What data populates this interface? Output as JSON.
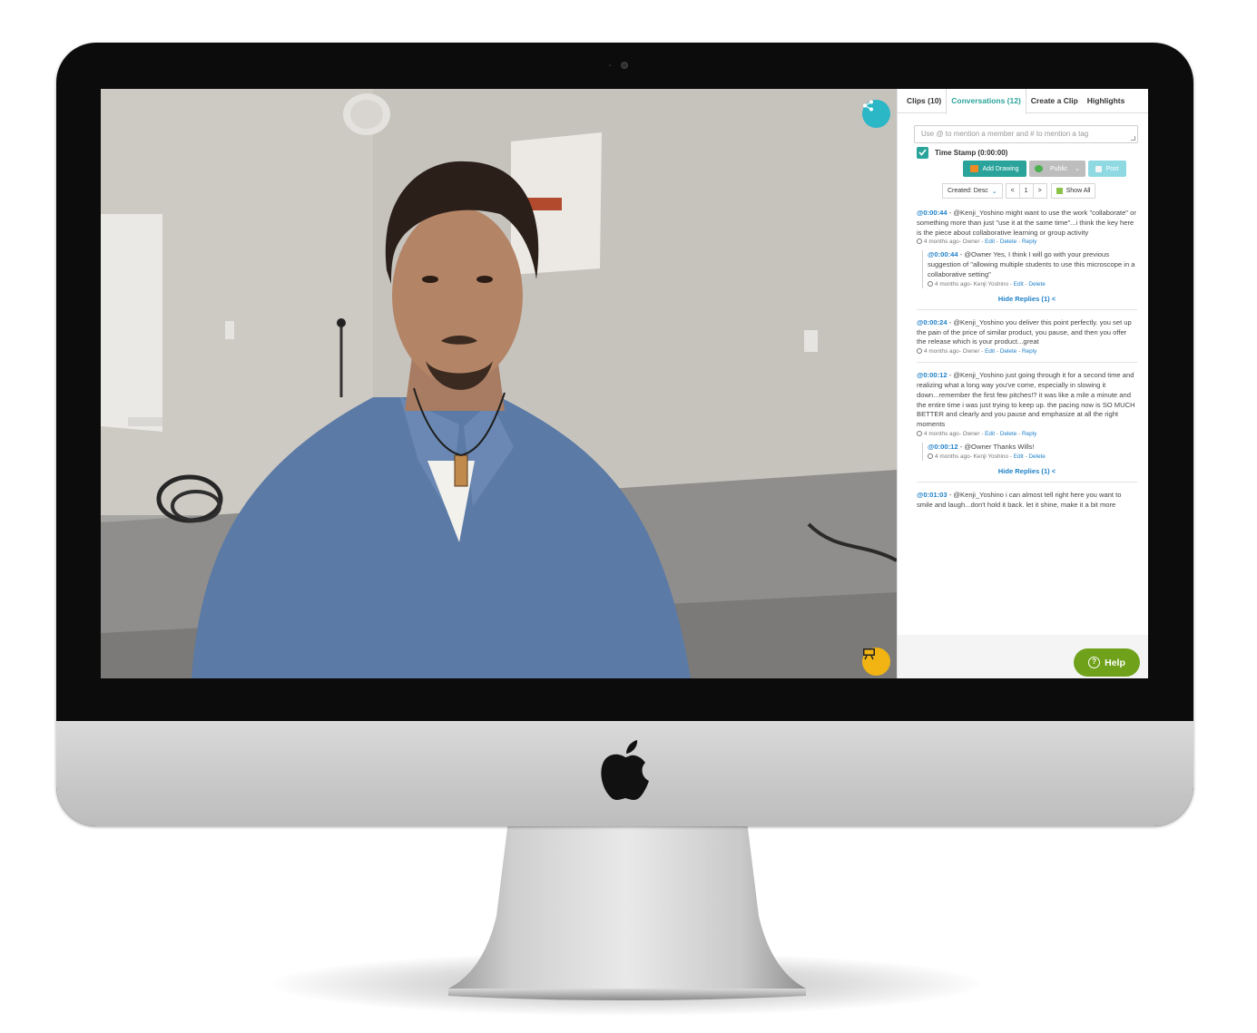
{
  "panel": {
    "tabs": [
      {
        "label": "Clips (10)",
        "active": false
      },
      {
        "label": "Conversations (12)",
        "active": true
      },
      {
        "label": "Create a Clip",
        "active": false
      },
      {
        "label": "Highlights",
        "active": false
      }
    ],
    "composer_placeholder": "Use @ to mention a member and # to mention a tag",
    "timestamp_label": "Time Stamp (0:00:00)",
    "timestamp_checked": true,
    "add_drawing_label": "Add Drawing",
    "visibility_value": "Public",
    "post_label": "Post",
    "sort_value": "Created: Desc",
    "pager": {
      "prev": "<",
      "page": "1",
      "next": ">"
    },
    "show_all_label": "Show All",
    "help_label": "Help"
  },
  "comments": [
    {
      "timestamp": "@0:00:44",
      "text": " - @Kenji_Yoshino might want to use the work \"collaborate\" or something more than just \"use it at the same time\"...i think the key here is the piece about collaborative learning or group activity",
      "meta_prefix": "4 months ago- Owner - ",
      "actions": [
        "Edit",
        "Delete",
        "Reply"
      ],
      "reply": {
        "timestamp": "@0:00:44",
        "text": " - @Owner Yes, I think I will go with your previous suggestion of \"allowing multiple students to use this microscope in a collaborative setting\"",
        "meta_prefix": "4 months ago- Kenji Yoshino - ",
        "actions": [
          "Edit",
          "Delete"
        ]
      },
      "hide_replies": "Hide Replies (1) <"
    },
    {
      "timestamp": "@0:00:24",
      "text": " - @Kenji_Yoshino you deliver this point perfectly. you set up the pain of the price of similar product, you pause, and then you offer the release which is your product...great",
      "meta_prefix": "4 months ago- Owner - ",
      "actions": [
        "Edit",
        "Delete",
        "Reply"
      ]
    },
    {
      "timestamp": "@0:00:12",
      "text": " - @Kenji_Yoshino just going through it for a second time and realizing what a long way you've come, especially in slowing it down...remember the first few pitches!? it was like a mile a minute and the entire time i was just trying to keep up. the pacing now is SO MUCH BETTER and clearly and you pause and emphasize at all the right moments",
      "meta_prefix": "4 months ago- Owner - ",
      "actions": [
        "Edit",
        "Delete",
        "Reply"
      ],
      "reply": {
        "timestamp": "@0:00:12",
        "text": " - @Owner Thanks Wills!",
        "meta_prefix": "4 months ago- Kenji Yoshino - ",
        "actions": [
          "Edit",
          "Delete"
        ]
      },
      "hide_replies": "Hide Replies (1) <"
    },
    {
      "timestamp": "@0:01:03",
      "text": " - @Kenji_Yoshino i can almost tell right here you want to smile and laugh...don't hold it back. let it shine, make it a bit more"
    }
  ],
  "colors": {
    "accent_teal": "#2aa39a",
    "link_blue": "#1f80c8",
    "share_button": "#2bb7c6",
    "draw_button": "#f2b413",
    "help_button": "#6fa21a"
  },
  "icons": [
    "camera-icon",
    "apple-logo-icon",
    "share-icon",
    "whiteboard-icon",
    "check-icon",
    "drawing-icon",
    "globe-icon",
    "chevron-down-icon",
    "post-icon",
    "clock-icon",
    "help-icon"
  ]
}
